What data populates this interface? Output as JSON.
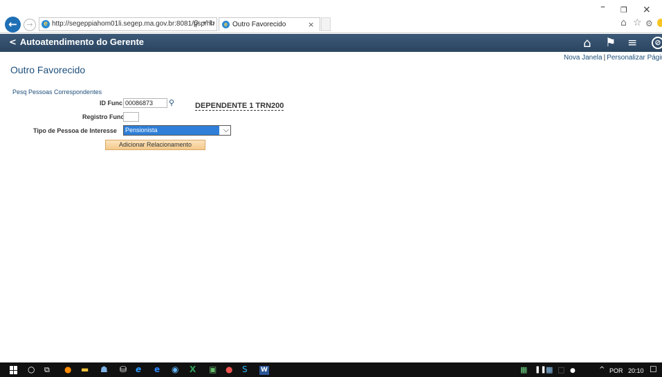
{
  "browser": {
    "url": "http://segeppiahom01li.segep.ma.gov.br:8081/psp/hn",
    "tab_title": "Outro Favorecido",
    "tab_close": "×",
    "back": "←",
    "forward": "→",
    "search_glyph": "⚲",
    "dropdown_glyph": "▾",
    "refresh_glyph": "↻",
    "minimize": "–",
    "restore": "❐",
    "close": "×",
    "home_glyph": "⌂",
    "favorites_glyph": "☆",
    "tools_glyph": "⚙"
  },
  "banner": {
    "back_chevron": "<",
    "back_label": "Autoatendimento do Gerente",
    "home_glyph": "⌂",
    "flag_glyph": "⚑",
    "menu_glyph": "≡",
    "compass_glyph": "⊘"
  },
  "links": {
    "new_window": "Nova Janela",
    "separator": "|",
    "personalize": "Personalizar Página"
  },
  "page": {
    "title": "Outro Favorecido",
    "section": "Pesq Pessoas Correspondentes",
    "id_func_label": "ID Func",
    "id_func_value": "00086873",
    "lookup_glyph": "⚲",
    "employee_name": "DEPENDENTE 1 TRN200",
    "registro_label": "Registro Func",
    "registro_value": "",
    "tipo_label": "Tipo de Pessoa de Interesse",
    "tipo_value": "Pensionista",
    "select_arrow": "⌵",
    "add_button": "Adicionar Relacionamento"
  },
  "taskbar": {
    "search_glyph": "○",
    "taskview_glyph": "⧉",
    "firefox_glyph": "●",
    "files_glyph": "▬",
    "people_glyph": "☗",
    "store_glyph": "⛁",
    "ie_glyph": "e",
    "edge_glyph": "e",
    "chrome_glyph": "◉",
    "excel_glyph": "X",
    "app2_glyph": "▣",
    "app3_glyph": "●",
    "skype_glyph": "S",
    "word_glyph": "W",
    "sys1_glyph": "▦",
    "sys2_glyph": "❚❚",
    "sys3_glyph": "▦",
    "sys4_glyph": "□",
    "sys5_glyph": "●",
    "chevron": "^",
    "language": "POR",
    "time": "20:10",
    "notif_glyph": "☐"
  },
  "colors": {
    "banner": "#2b4560",
    "link": "#1d4e7a",
    "select_highlight": "#2f7fd8",
    "button": "#f4c98a"
  }
}
